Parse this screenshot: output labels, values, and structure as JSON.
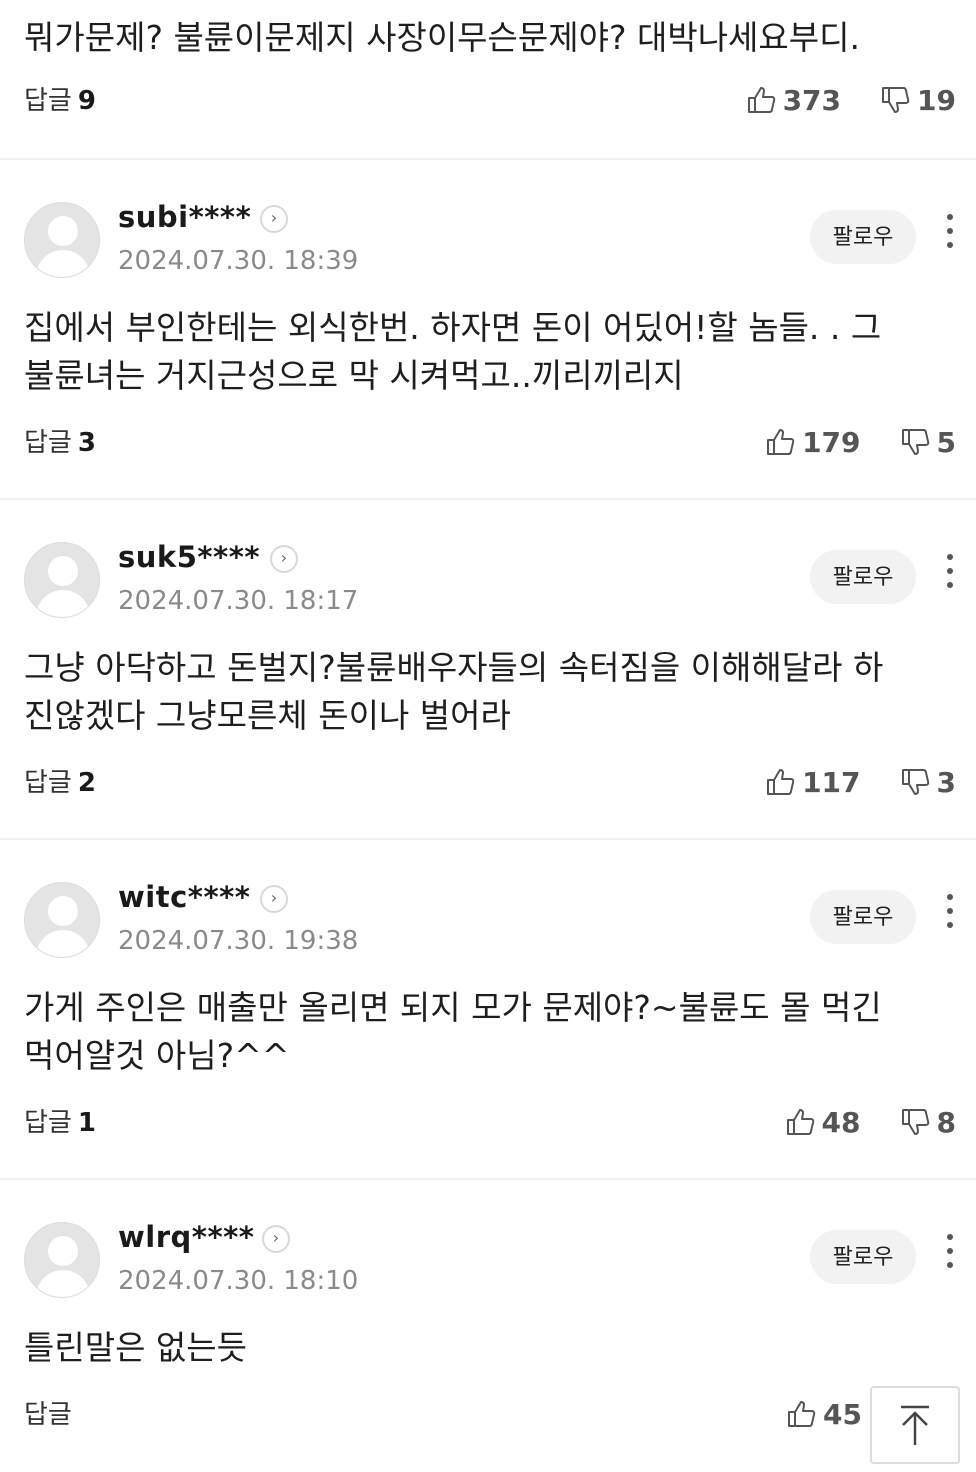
{
  "reply_label": "답글",
  "follow_label": "팔로우",
  "comments": [
    {
      "body_line1": "뭐가문제? 불륜이문제지 사장이무슨문제야? 대박나세요부디.",
      "reply_count": "9",
      "likes": "373",
      "dislikes": "19"
    },
    {
      "nickname": "subi****",
      "date": "2024.07.30. 18:39",
      "body_line1": "집에서 부인한테는 외식한번. 하자면 돈이 어딨어!할 놈들. . 그",
      "body_line2": "불륜녀는 거지근성으로 막 시켜먹고..끼리끼리지",
      "reply_count": "3",
      "likes": "179",
      "dislikes": "5"
    },
    {
      "nickname": "suk5****",
      "date": "2024.07.30. 18:17",
      "body_line1": "그냥 아닥하고 돈벌지?불륜배우자들의 속터짐을 이해해달라 하",
      "body_line2": "진않겠다 그냥모른체 돈이나 벌어라",
      "reply_count": "2",
      "likes": "117",
      "dislikes": "3"
    },
    {
      "nickname": "witc****",
      "date": "2024.07.30. 19:38",
      "body_line1": "가게 주인은 매출만 올리면 되지 모가 문제야?~불륜도 몰 먹긴",
      "body_line2": "먹어얄것 아님?^^",
      "reply_count": "1",
      "likes": "48",
      "dislikes": "8"
    },
    {
      "nickname": "wlrq****",
      "date": "2024.07.30. 18:10",
      "body_line1": "틀린말은 없는듯",
      "likes": "45"
    }
  ],
  "icons": {
    "profile": "chevron-right-circle-icon",
    "like": "thumbs-up-icon",
    "dislike": "thumbs-down-icon",
    "menu": "kebab-menu-icon",
    "top": "arrow-up-to-top-icon"
  }
}
